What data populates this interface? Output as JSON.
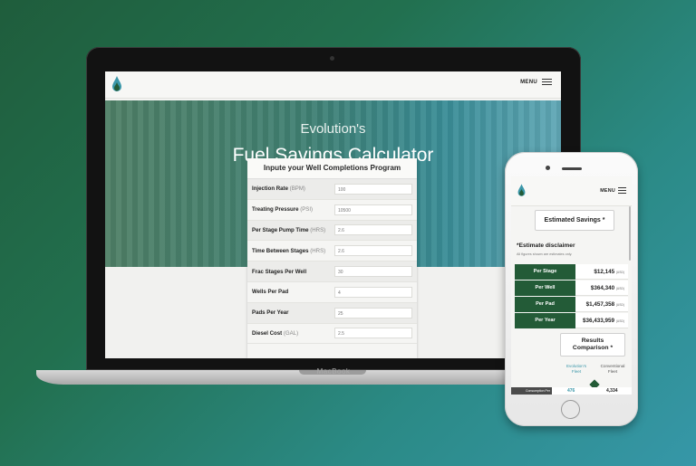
{
  "laptop": {
    "brand": "MacBook",
    "header": {
      "menu_label": "MENU"
    },
    "hero": {
      "subtitle": "Evolution's",
      "title": "Fuel Savings Calculator"
    },
    "form": {
      "title": "Inpute your Well Completions Program",
      "fields": [
        {
          "label": "Injection Rate",
          "unit": "(BPM)",
          "value": "100"
        },
        {
          "label": "Treating Pressure",
          "unit": "(PSI)",
          "value": "10500"
        },
        {
          "label": "Per Stage Pump Time",
          "unit": "(HRS)",
          "value": "2.6"
        },
        {
          "label": "Time Between Stages",
          "unit": "(HRS)",
          "value": "2.6"
        },
        {
          "label": "Frac Stages Per Well",
          "unit": "",
          "value": "30"
        },
        {
          "label": "Wells Per Pad",
          "unit": "",
          "value": "4"
        },
        {
          "label": "Pads Per Year",
          "unit": "",
          "value": "25"
        },
        {
          "label": "Diesel Cost",
          "unit": "(GAL)",
          "value": "2.5"
        }
      ]
    }
  },
  "phone": {
    "header": {
      "menu_label": "MENU"
    },
    "estimated_button": "Estimated Savings *",
    "disclaimer": "*Estimate disclaimer",
    "disclaimer_note": "All figures shown are estimates only.",
    "savings": [
      {
        "label": "Per Stage",
        "value": "$12,145",
        "unit": "(USD)"
      },
      {
        "label": "Per Well",
        "value": "$364,340",
        "unit": "(USD)"
      },
      {
        "label": "Per Pad",
        "value": "$1,457,358",
        "unit": "(USD)"
      },
      {
        "label": "Per Year",
        "value": "$36,433,959",
        "unit": "(USD)"
      }
    ],
    "results_button_line1": "Results",
    "results_button_line2": "Comparison *",
    "col_evolution": "Evolution's Fleet",
    "col_conventional": "Conventional Fleet",
    "bottom_label": "Consumption Per",
    "value_evolution": "476",
    "value_conventional": "4,334"
  },
  "colors": {
    "brand_green": "#235b37",
    "accent_teal": "#3b97a9"
  }
}
